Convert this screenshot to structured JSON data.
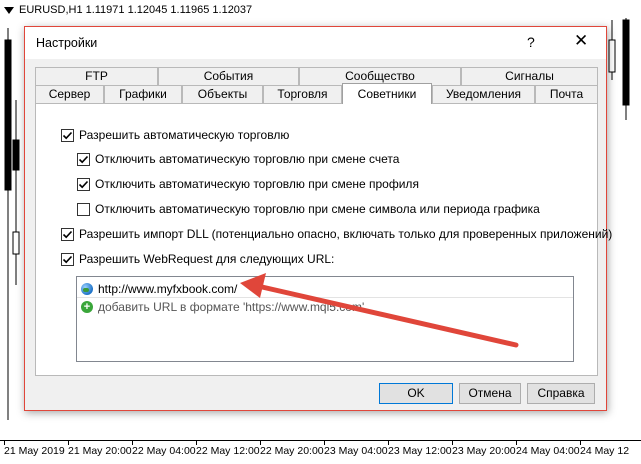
{
  "chart": {
    "symbol": "EURUSD,H1",
    "quote": "1.11971 1.12045 1.11965 1.12037",
    "time_labels": [
      "21 May 2019",
      "21 May 20:00",
      "22 May 04:00",
      "22 May 12:00",
      "22 May 20:00",
      "23 May 04:00",
      "23 May 12:00",
      "23 May 20:00",
      "24 May 04:00",
      "24 May 12"
    ]
  },
  "dialog": {
    "title": "Настройки",
    "help": "?",
    "close": "✕",
    "tabs_row1": [
      "FTP",
      "События",
      "Сообщество",
      "Сигналы"
    ],
    "tabs_row2": [
      "Сервер",
      "Графики",
      "Объекты",
      "Торговля",
      "Советники",
      "Уведомления",
      "Почта"
    ],
    "active_tab": "Советники",
    "options": [
      {
        "label": "Разрешить автоматическую торговлю",
        "checked": true
      },
      {
        "label": "Отключить автоматическую торговлю при смене счета",
        "checked": true
      },
      {
        "label": "Отключить автоматическую торговлю при смене профиля",
        "checked": true
      },
      {
        "label": "Отключить автоматическую торговлю при смене символа или периода графика",
        "checked": false
      },
      {
        "label": "Разрешить импорт DLL (потенциально опасно, включать только для проверенных приложений)",
        "checked": true
      },
      {
        "label": "Разрешить WebRequest для следующих URL:",
        "checked": true
      }
    ],
    "url_list": {
      "items": [
        "http://www.myfxbook.com/"
      ],
      "add_placeholder": "добавить URL в формате 'https://www.mql5.com'"
    },
    "buttons": {
      "ok": "OK",
      "cancel": "Отмена",
      "help": "Справка"
    },
    "accent_color": "#0078d7",
    "arrow_color": "#e0463a"
  }
}
